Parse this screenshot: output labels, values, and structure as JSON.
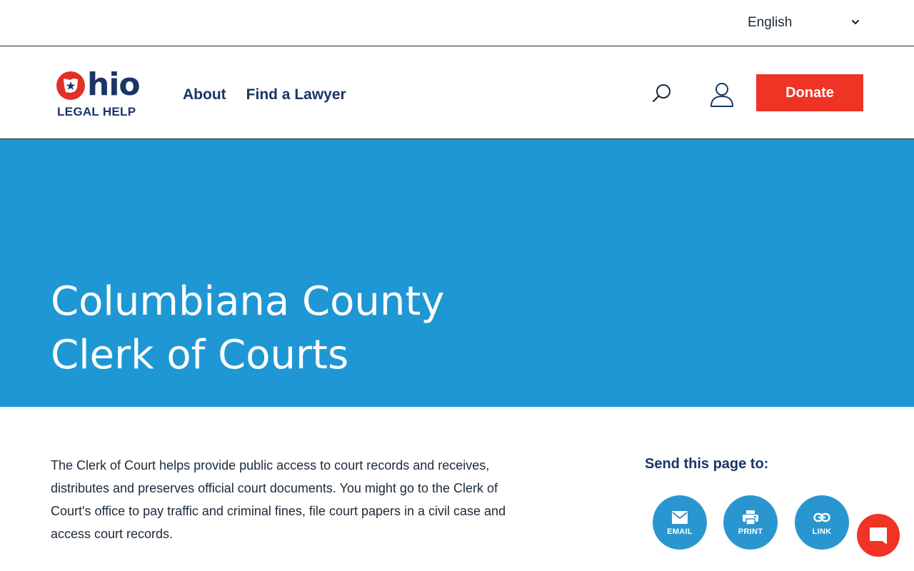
{
  "language": {
    "selected": "English"
  },
  "logo": {
    "brand": "Ohio",
    "tagline": "LEGAL HELP"
  },
  "nav": {
    "about": "About",
    "find_lawyer": "Find a Lawyer"
  },
  "header": {
    "donate_label": "Donate"
  },
  "hero": {
    "title_line1": "Columbiana County",
    "title_line2": "Clerk of Courts"
  },
  "content": {
    "intro": "The Clerk of Court helps provide public access to court records and receives, distributes and preserves official court documents. You might go to the Clerk of Court's office to pay traffic and criminal fines, file court papers in a civil case and access court records."
  },
  "share": {
    "title": "Send this page to:",
    "email_label": "EMAIL",
    "print_label": "PRINT",
    "link_label": "LINK"
  },
  "colors": {
    "brand_red": "#ef3324",
    "hero_blue": "#1e97d4",
    "navy": "#1b3566",
    "share_blue": "#2a96cf"
  },
  "icons": [
    "chevron-down-icon",
    "ohio-state-icon",
    "search-icon",
    "user-icon",
    "email-icon",
    "print-icon",
    "link-icon",
    "chat-icon"
  ]
}
